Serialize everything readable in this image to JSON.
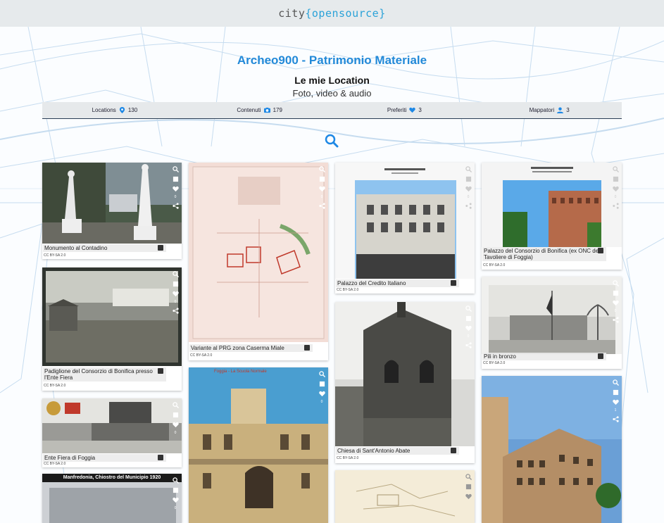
{
  "brand": {
    "city": "city",
    "rest": "{opensource}"
  },
  "title": "Archeo900 - Patrimonio Materiale",
  "subtitle": "Le mie Location",
  "subsubtitle": "Foto, video & audio",
  "stats": [
    {
      "label": "Locations",
      "icon": "map-pin-icon",
      "value": "130"
    },
    {
      "label": "Contenuti",
      "icon": "camera-icon",
      "value": "179"
    },
    {
      "label": "Preferiti",
      "icon": "heart-icon",
      "value": "3"
    },
    {
      "label": "Mappatori",
      "icon": "user-icon",
      "value": "3"
    }
  ],
  "license": "CC BY-SA 2.0",
  "colors": {
    "accent": "#2289d8",
    "topbar": "#e6eaec"
  },
  "cards": [
    {
      "caption": "Monumento al Contadino",
      "count": "0"
    },
    {
      "caption": "Padiglione del Consorzio di Bonifica presso l'Ente Fiera",
      "count": "0"
    },
    {
      "caption": "Ente Fiera di Foggia",
      "count": "0"
    },
    {
      "caption": "Manfredonia, Chiostro del Municipio 1920",
      "count": "0"
    },
    {
      "caption": "Variante al PRG zona Caserma Miale",
      "count": "0"
    },
    {
      "caption": "Foggia - La Scuola Normale",
      "count": "0"
    },
    {
      "caption": "Palazzo del Credito Italiano",
      "count": "0"
    },
    {
      "caption": "Chiesa di Sant'Antonio Abate",
      "count": "0"
    },
    {
      "caption": "Palazzo del Consorzio di Bonifica (ex ONC del Tavoliere di Foggia)",
      "count": "0"
    },
    {
      "caption": "Pili in bronzo",
      "count": "0"
    },
    {
      "caption": "",
      "count": "1"
    }
  ]
}
